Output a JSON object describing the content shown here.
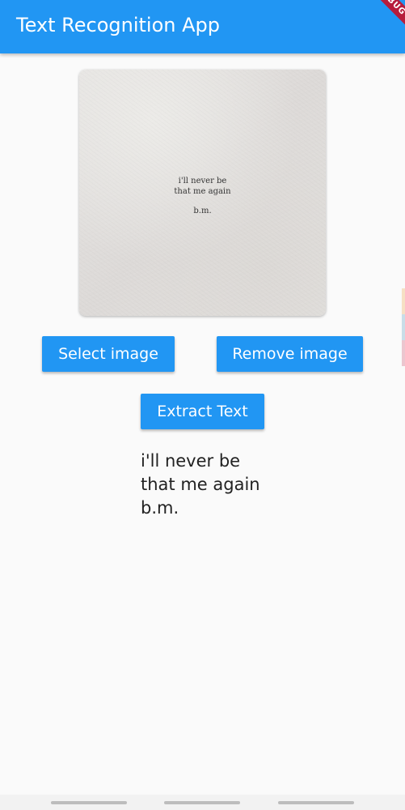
{
  "app_bar": {
    "title": "Text Recognition App",
    "background": "#2196f3",
    "debug_label": "DEBUG"
  },
  "image": {
    "poem_lines": [
      "i'll never be",
      "that me again",
      "b.m."
    ]
  },
  "buttons": {
    "select_label": "Select image",
    "remove_label": "Remove image",
    "extract_label": "Extract Text"
  },
  "result": {
    "lines": [
      "i'll never be",
      "that me again",
      "b.m."
    ]
  },
  "colors": {
    "accent": "#2196f3",
    "background": "#fafafa"
  }
}
